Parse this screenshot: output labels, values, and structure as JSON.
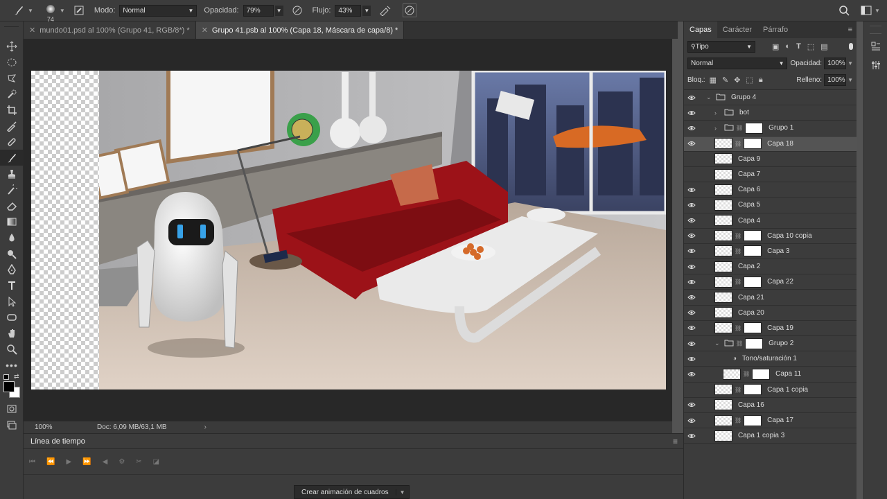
{
  "options_bar": {
    "brush_size": "74",
    "mode_label": "Modo:",
    "mode_value": "Normal",
    "opacity_label": "Opacidad:",
    "opacity_value": "79%",
    "flow_label": "Flujo:",
    "flow_value": "43%"
  },
  "document_tabs": [
    {
      "label": "mundo01.psd al 100% (Grupo 41, RGB/8*) *",
      "active": false
    },
    {
      "label": "Grupo 41.psb al 100% (Capa 18, Máscara de capa/8) *",
      "active": true
    }
  ],
  "status": {
    "zoom": "100%",
    "doc": "Doc: 6,09 MB/63,1 MB"
  },
  "timeline": {
    "title": "Línea de tiempo",
    "create_button": "Crear animación de cuadros"
  },
  "layers_panel": {
    "tabs": [
      "Capas",
      "Carácter",
      "Párrafo"
    ],
    "filter_kind": "Tipo",
    "blend_mode": "Normal",
    "opacity_label": "Opacidad:",
    "opacity_value": "100%",
    "lock_label": "Bloq.:",
    "fill_label": "Relleno:",
    "fill_value": "100%",
    "layers": [
      {
        "name": "Grupo 4",
        "type": "group",
        "visible": true,
        "expanded": true,
        "indent": 0
      },
      {
        "name": "bot",
        "type": "group",
        "visible": true,
        "expanded": false,
        "indent": 1
      },
      {
        "name": "Grupo 1",
        "type": "group",
        "visible": true,
        "expanded": false,
        "indent": 1,
        "mask": true
      },
      {
        "name": "Capa 18",
        "type": "layer",
        "visible": true,
        "selected": true,
        "indent": 1,
        "mask": true
      },
      {
        "name": "Capa 9",
        "type": "layer",
        "visible": false,
        "indent": 1
      },
      {
        "name": "Capa 7",
        "type": "layer",
        "visible": false,
        "indent": 1
      },
      {
        "name": "Capa 6",
        "type": "layer",
        "visible": true,
        "indent": 1
      },
      {
        "name": "Capa 5",
        "type": "layer",
        "visible": true,
        "indent": 1
      },
      {
        "name": "Capa 4",
        "type": "layer",
        "visible": true,
        "indent": 1
      },
      {
        "name": "Capa 10 copia",
        "type": "layer",
        "visible": true,
        "indent": 1,
        "mask": true
      },
      {
        "name": "Capa 3",
        "type": "layer",
        "visible": true,
        "indent": 1,
        "mask": true
      },
      {
        "name": "Capa 2",
        "type": "layer",
        "visible": true,
        "indent": 1
      },
      {
        "name": "Capa 22",
        "type": "layer",
        "visible": true,
        "indent": 1,
        "mask": true
      },
      {
        "name": "Capa 21",
        "type": "layer",
        "visible": true,
        "indent": 1
      },
      {
        "name": "Capa 20",
        "type": "layer",
        "visible": true,
        "indent": 1
      },
      {
        "name": "Capa 19",
        "type": "layer",
        "visible": true,
        "indent": 1,
        "mask": true
      },
      {
        "name": "Grupo 2",
        "type": "group",
        "visible": true,
        "expanded": true,
        "indent": 1,
        "mask": true
      },
      {
        "name": "Tono/saturación 1",
        "type": "adjustment",
        "visible": true,
        "indent": 2
      },
      {
        "name": "Capa 11",
        "type": "layer",
        "visible": true,
        "indent": 2,
        "mask": true
      },
      {
        "name": "Capa 1 copia",
        "type": "layer",
        "visible": false,
        "indent": 1,
        "mask": true
      },
      {
        "name": "Capa 16",
        "type": "layer",
        "visible": true,
        "indent": 1
      },
      {
        "name": "Capa 17",
        "type": "layer",
        "visible": true,
        "indent": 1,
        "mask": true
      },
      {
        "name": "Capa 1 copia 3",
        "type": "layer",
        "visible": true,
        "indent": 1
      }
    ]
  },
  "colors": {
    "foreground": "#000000",
    "background": "#ffffff",
    "panel": "#3c3c3c",
    "selected_layer": "#545454"
  }
}
